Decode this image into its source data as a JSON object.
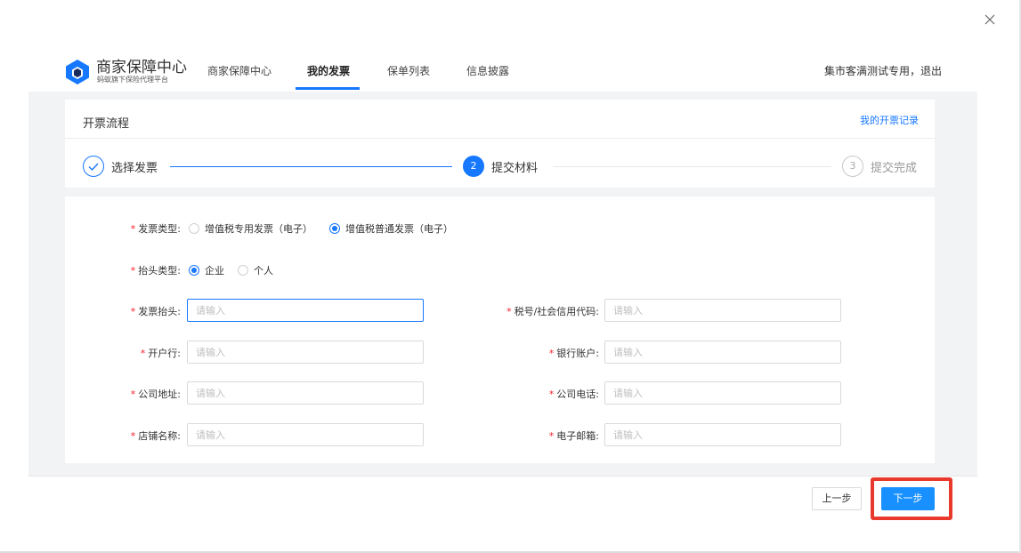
{
  "header": {
    "brand_title": "商家保障中心",
    "brand_subtitle": "蚂蚁旗下保险代理平台",
    "nav": [
      "商家保障中心",
      "我的发票",
      "保单列表",
      "信息披露"
    ],
    "active_nav": "我的发票",
    "user_text": "集市客满测试专用，退出"
  },
  "process": {
    "title": "开票流程",
    "records_link": "我的开票记录",
    "steps": [
      {
        "number": "✓",
        "label": "选择发票",
        "status": "done"
      },
      {
        "number": "2",
        "label": "提交材料",
        "status": "active"
      },
      {
        "number": "3",
        "label": "提交完成",
        "status": "waiting"
      }
    ]
  },
  "form": {
    "invoice_type": {
      "label": "发票类型:",
      "options": [
        "增值税专用发票（电子）",
        "增值税普通发票（电子）"
      ],
      "selected": "增值税普通发票（电子）"
    },
    "title_type": {
      "label": "抬头类型:",
      "options": [
        "企业",
        "个人"
      ],
      "selected": "企业"
    },
    "fields": [
      {
        "label": "发票抬头:",
        "value": "",
        "placeholder": "请输入"
      },
      {
        "label": "税号/社会信用代码:",
        "value": "",
        "placeholder": "请输入"
      },
      {
        "label": "开户行:",
        "value": "",
        "placeholder": "请输入"
      },
      {
        "label": "银行账户:",
        "value": "",
        "placeholder": "请输入"
      },
      {
        "label": "公司地址:",
        "value": "",
        "placeholder": "请输入"
      },
      {
        "label": "公司电话:",
        "value": "",
        "placeholder": "请输入"
      },
      {
        "label": "店铺名称:",
        "value": "",
        "placeholder": "请输入"
      },
      {
        "label": "电子邮箱:",
        "value": "",
        "placeholder": "请输入"
      }
    ]
  },
  "footer": {
    "prev_label": "上一步",
    "next_label": "下一步"
  },
  "colors": {
    "accent": "#1677ff",
    "required": "#f5222d",
    "highlight": "#e8392c",
    "page_bg": "#f2f3f5"
  },
  "icons": [
    "close-icon",
    "logo-icon",
    "check-icon"
  ]
}
